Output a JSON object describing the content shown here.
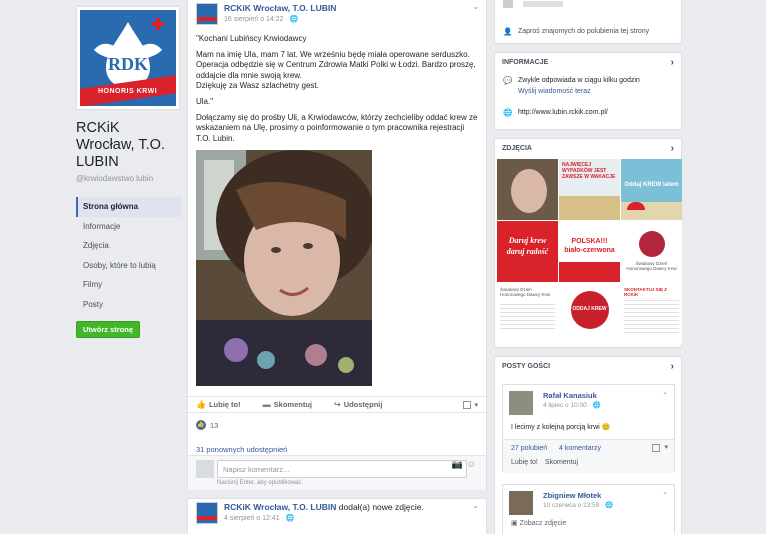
{
  "colors": {
    "fb_blue": "#4267b2",
    "link": "#365899",
    "green_button": "#42b72a",
    "logo_blue": "#2a6ab0",
    "logo_red": "#d9222a"
  },
  "left": {
    "logo_text": "HONORIS KRWI",
    "page_name": "RCKiK Wrocław, T.O. LUBIN",
    "handle": "@krwiodawstwo lubin",
    "nav": [
      "Strona główna",
      "Informacje",
      "Zdjęcia",
      "Osoby, które to lubią",
      "Filmy",
      "Posty"
    ],
    "create_page": "Utwórz stronę"
  },
  "post1": {
    "author": "RCKiK Wrocław, T.O. LUBIN",
    "time": "16 sierpień o 14:22 · 🌐",
    "paragraphs": [
      "\"Kochani Lubińscy Krwiodawcy",
      "Mam na imię Ula, mam 7 lat. We wrześniu będę miała operowane serduszko. Operacja odbędzie się w Centrum Zdrowia Matki Polki w Łodzi. Bardzo proszę, oddajcie dla mnie swoją krew.\nDziękuję za Wasz szlachetny gest.",
      "Ula.\"",
      "Dołączamy się do prośby Uli, a Krwiodawców, którzy zechcieliby oddać krew ze wskazaniem na Ulę, prosimy o poinformowanie o tym pracownika rejestracji T.O. Lubin."
    ],
    "actions": {
      "like": "Lubię to!",
      "comment": "Skomentuj",
      "share": "Udostępnij"
    },
    "like_count": "13",
    "shares": "31 ponownych udostępnień",
    "comment_placeholder": "Napisz komentarz...",
    "comment_hint": "Naciśnij Enter, aby opublikować."
  },
  "post2": {
    "author": "RCKiK Wrocław, T.O. LUBIN",
    "added": "dodał(a) nowe zdjęcie.",
    "time": "4 sierpień o 12:41 · 🌐"
  },
  "right": {
    "invite": "Zaproś znajomych do polubienia tej strony",
    "info_title": "INFORMACJE",
    "info_response": "Zwykle odpowiada w ciągu kilku godzin",
    "info_send": "Wyślij wiadomość teraz",
    "info_url": "http://www.lubin.rckik.com.pl/",
    "photos_title": "ZDJĘCIA",
    "photo_texts": [
      "",
      "NAJWIĘCEJ WYPADKÓW JEST ZAWSZE W WAKACJE",
      "Oddaj KREW latem",
      "Daruj krew daruj radość",
      "POLSKA!!! biało-czerwona",
      "Światowy Dzień Honorowego Dawcy Krwi",
      "Światowy Dzień Honorowego Dawcy Krwi",
      "ODDAJ KREW",
      "SKONTAKTUJ SIĘ Z RCKiK"
    ],
    "guests_title": "POSTY GOŚCI",
    "guest1": {
      "name": "Rafał Kanasiuk",
      "time": "4 lipiec o 10:00 · 🌐",
      "text": "I lecimy z kolejną porcją krwi 😊",
      "likes": "27 polubień",
      "comments": "4 komentarzy",
      "like": "Lubię to!",
      "comment": "Skomentuj"
    },
    "guest2": {
      "name": "Zbigniew Młotek",
      "time": "10 czerwca o 23:59 · 🌐",
      "photo_link": "Zobacz zdjęcie"
    }
  }
}
